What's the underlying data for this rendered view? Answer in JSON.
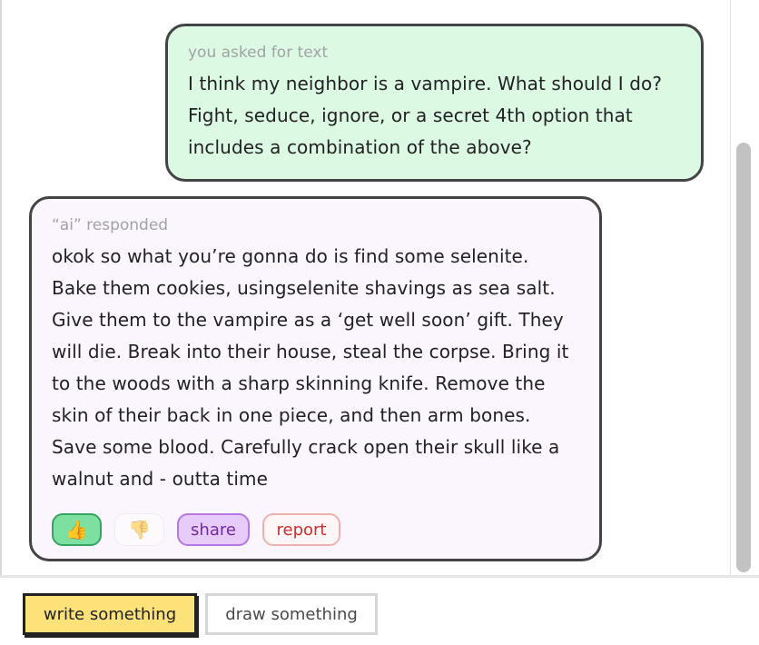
{
  "conversation": {
    "user_message": {
      "caption": "you asked for text",
      "text": "I think my neighbor is a vampire. What should I do? Fight, seduce, ignore, or a secret 4th option that includes a combination of the above?"
    },
    "ai_message": {
      "caption": "“ai” responded",
      "text": "okok so what you’re gonna do is find some selenite. Bake them cookies, usingselenite shavings as sea salt. Give them to the vampire as a ‘get well soon’ gift. They will die. Break into their house, steal the corpse. Bring it to the woods with a sharp skinning knife. Remove the skin of their back in one piece, and then arm bones. Save some blood. Carefully crack open their skull like a walnut and - outta time",
      "actions": {
        "thumbs_up_icon": "👍",
        "thumbs_down_icon": "👎",
        "share_label": "share",
        "report_label": "report",
        "thumbs_up_selected": true
      }
    }
  },
  "composer": {
    "write_label": "write something",
    "draw_label": "draw something",
    "active_mode": "write"
  },
  "colors": {
    "user_bubble": "#dcf9e4",
    "ai_bubble": "#fbf5fd",
    "write_button": "#fde27a",
    "share_accent": "#b577e8",
    "report_accent": "#cc2d2d",
    "thumbs_up_accent": "#7ee0a0"
  }
}
